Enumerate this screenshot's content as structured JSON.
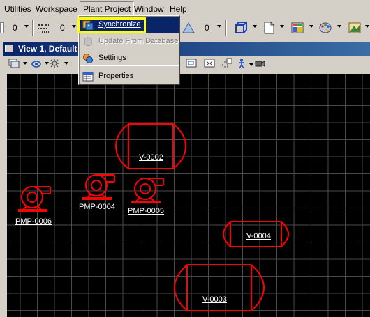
{
  "menubar": {
    "items": [
      {
        "label": "Utilities"
      },
      {
        "label": "Workspace"
      },
      {
        "label": "Plant Project"
      },
      {
        "label": "Window"
      },
      {
        "label": "Help"
      }
    ]
  },
  "toolbar": {
    "line_weight_value": "0",
    "line_style_value": "0",
    "third_value": "0"
  },
  "view": {
    "title": "View 1, Default"
  },
  "plant_menu": {
    "items": [
      {
        "label": "Synchronize",
        "state": "selected"
      },
      {
        "label": "Update From Database",
        "state": "disabled"
      },
      {
        "label": "Settings",
        "state": "normal"
      },
      {
        "label": "Properties",
        "state": "normal"
      }
    ]
  },
  "drawing": {
    "vessels": [
      {
        "tag": "V-0002"
      },
      {
        "tag": "V-0004"
      },
      {
        "tag": "V-0003"
      }
    ],
    "pumps": [
      {
        "tag": "PMP-0006"
      },
      {
        "tag": "PMP-0004"
      },
      {
        "tag": "PMP-0005"
      }
    ],
    "colors": {
      "equipment": "#ff0000",
      "grid": "#4a4a4a",
      "background": "#000000",
      "label": "#ffffff"
    }
  }
}
